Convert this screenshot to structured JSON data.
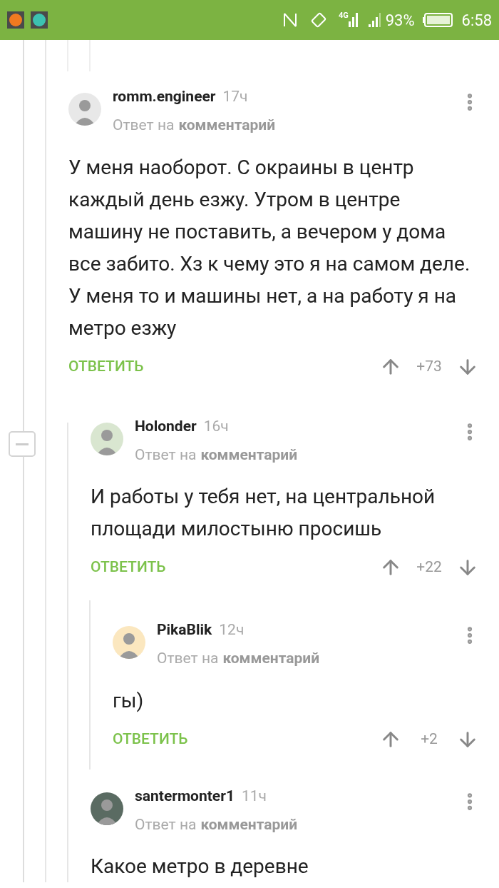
{
  "status_bar": {
    "network_type": "4G",
    "battery": "93%",
    "time": "6:58"
  },
  "comments": [
    {
      "author": "romm.engineer",
      "time": "17ч",
      "reply_prefix": "Ответ на",
      "reply_target": "комментарий",
      "text": "У меня наоборот. С окраины в центр каждый день езжу. Утром в центре машину не поставить, а вечером у дома все забито. Хз к чему это я на самом деле. У меня то и машины нет, а на работу я на метро езжу",
      "reply_button": "ОТВЕТИТЬ",
      "score": "+73",
      "children": [
        {
          "author": "Holonder",
          "time": "16ч",
          "reply_prefix": "Ответ на",
          "reply_target": "комментарий",
          "text": "И работы у тебя нет, на центральной площади милостыню просишь",
          "reply_button": "ОТВЕТИТЬ",
          "score": "+22",
          "collapsible": true,
          "children": [
            {
              "author": "PikaBlik",
              "time": "12ч",
              "reply_prefix": "Ответ на",
              "reply_target": "комментарий",
              "text": "гы)",
              "reply_button": "ОТВЕТИТЬ",
              "score": "+2"
            }
          ]
        },
        {
          "author": "santermonter1",
          "time": "11ч",
          "reply_prefix": "Ответ на",
          "reply_target": "комментарий",
          "text": "Какое метро в деревне"
        }
      ]
    }
  ]
}
